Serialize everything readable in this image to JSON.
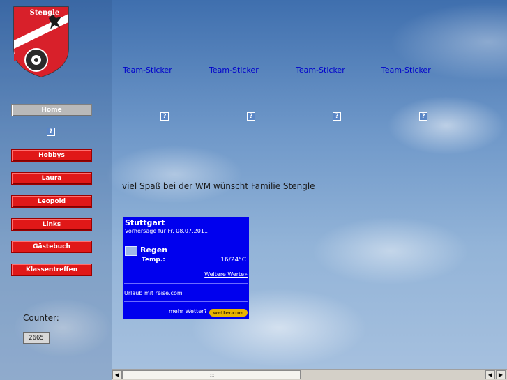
{
  "logo": {
    "text": "Stengle",
    "icon": "coat-of-arms-icon"
  },
  "nav": {
    "home": "Home",
    "items": [
      {
        "label": "Hobbys"
      },
      {
        "label": "Laura"
      },
      {
        "label": "Leopold"
      },
      {
        "label": "Links"
      },
      {
        "label": "Gästebuch"
      },
      {
        "label": "Klassentreffen"
      }
    ],
    "missing_image_icon": "?"
  },
  "counter": {
    "label": "Counter:",
    "value": "2665"
  },
  "stickers": [
    {
      "label": "Team-Sticker"
    },
    {
      "label": "Team-Sticker"
    },
    {
      "label": "Team-Sticker"
    },
    {
      "label": "Team-Sticker"
    }
  ],
  "message": "viel Spaß bei der WM wünscht Familie Stengle",
  "weather": {
    "city": "Stuttgart",
    "forecast": "Vorhersage für Fr. 08.07.2011",
    "condition": "Regen",
    "temp_label": "Temp.:",
    "temp_value": "16/24°C",
    "more_values": "Weitere Werte»",
    "travel_link": "Urlaub mit reise.com",
    "more_weather": "mehr Wetter?",
    "brand": "wetter.com",
    "bg_color": "#0000ee"
  },
  "scrollbar": {
    "left_arrow": "◀",
    "right_arrow": "▶",
    "grip": "::::"
  }
}
